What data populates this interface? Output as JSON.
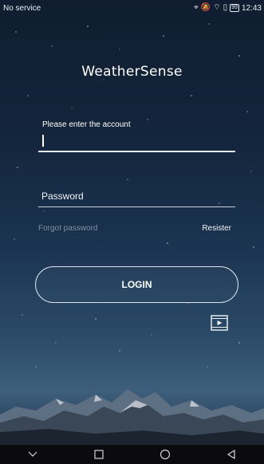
{
  "status_bar": {
    "carrier": "No service",
    "battery": "99",
    "time": "12:43",
    "icons": [
      "location-icon",
      "mute-icon",
      "wifi-icon",
      "sim-icon",
      "battery-icon"
    ]
  },
  "app": {
    "logo_text": "WeatherSense"
  },
  "login_form": {
    "account_placeholder": "Please enter the account",
    "account_value": "",
    "password_placeholder": "Password",
    "password_value": "",
    "forgot_password": "Forgot password",
    "register": "Resister",
    "login_button": "LOGIN"
  },
  "icons": {
    "video": "video-play-icon"
  },
  "nav_bar": {
    "buttons": [
      "back-chevron-icon",
      "recent-apps-icon",
      "home-icon",
      "back-icon"
    ]
  },
  "colors": {
    "sky_top": "#101d30",
    "sky_bottom": "#3d5f7c",
    "forgot_text": "#7f8fa3",
    "nav_bar": "#0b0b0d"
  }
}
